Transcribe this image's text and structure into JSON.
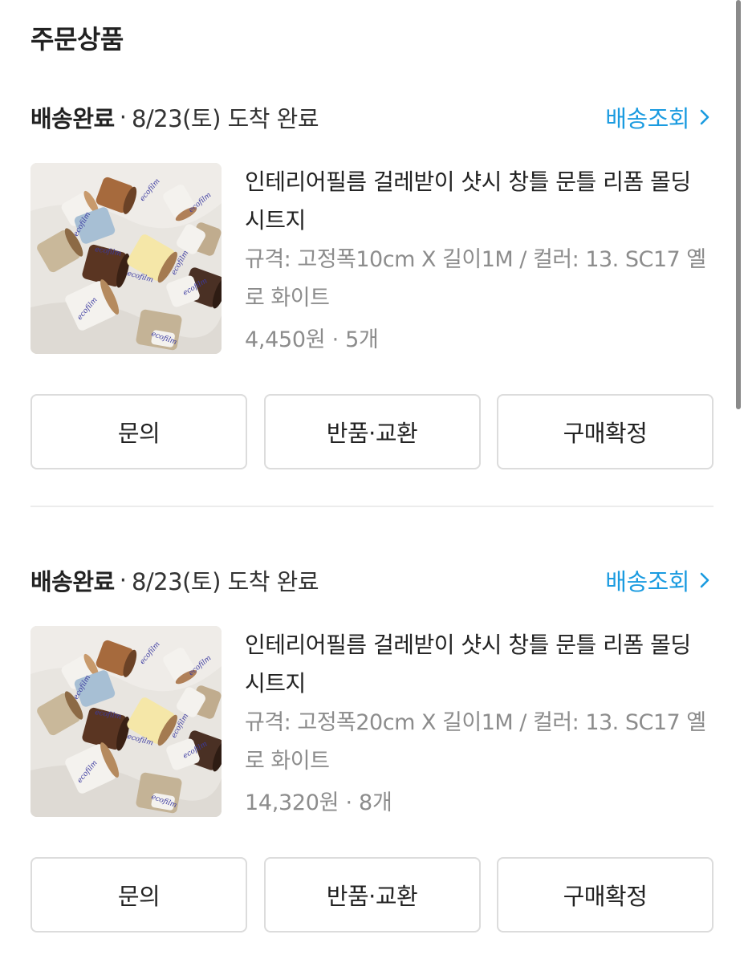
{
  "section_title": "주문상품",
  "orders": [
    {
      "status": "배송완료",
      "separator": "·",
      "arrival": "8/23(토) 도착 완료",
      "track_label": "배송조회",
      "product": {
        "name": "인테리어필름 걸레받이 샷시 창틀 문틀 리폼 몰딩 시트지",
        "option": "규격: 고정폭10cm X 길이1M / 컬러: 13. SC17 옐로 화이트",
        "price": "4,450원 · 5개",
        "image_alt": "ecofilm 롤 필름 사진"
      },
      "buttons": [
        "문의",
        "반품·교환",
        "구매확정"
      ]
    },
    {
      "status": "배송완료",
      "separator": "·",
      "arrival": "8/23(토) 도착 완료",
      "track_label": "배송조회",
      "product": {
        "name": "인테리어필름 걸레받이 샷시 창틀 문틀 리폼 몰딩 시트지",
        "option": "규격: 고정폭20cm X 길이1M / 컬러: 13. SC17 옐로 화이트",
        "price": "14,320원 · 8개",
        "image_alt": "ecofilm 롤 필름 사진"
      },
      "buttons": [
        "문의",
        "반품·교환",
        "구매확정"
      ]
    }
  ],
  "colors": {
    "link": "#1a9be0",
    "muted_text": "#8c8c8c",
    "border": "#dcdcdc"
  }
}
